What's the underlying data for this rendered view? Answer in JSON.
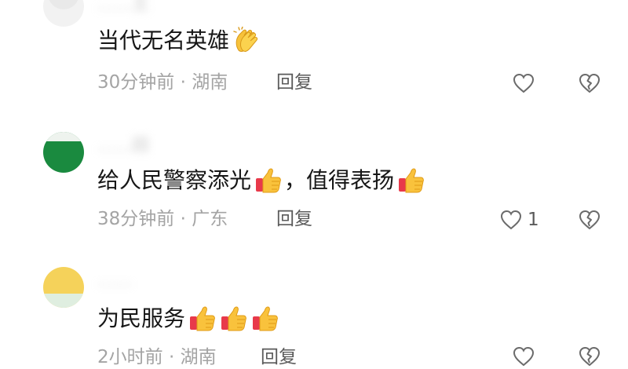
{
  "comments": [
    {
      "username": "……王",
      "text": "当代无名英雄",
      "emojis": [
        "clapping-hands"
      ],
      "meta": "30分钟前 · 湖南",
      "reply_label": "回复",
      "like_count": "",
      "avatar_color": "#f2f2f2"
    },
    {
      "username": "……田",
      "text_parts": [
        "给人民警察添光",
        "，值得表扬"
      ],
      "emojis": [
        "thumbs-up",
        "thumbs-up"
      ],
      "meta": "38分钟前 · 广东",
      "reply_label": "回复",
      "like_count": "1",
      "avatar_color": "#1a8a3f"
    },
    {
      "username": "……",
      "text": "为民服务",
      "emojis": [
        "thumbs-up",
        "thumbs-up",
        "thumbs-up"
      ],
      "meta": "2小时前 · 湖南",
      "reply_label": "回复",
      "like_count": "",
      "avatar_color": "#f5d25a"
    }
  ],
  "colors": {
    "text": "#161616",
    "meta": "#a4a4a4",
    "icon": "#6b6b6b"
  }
}
